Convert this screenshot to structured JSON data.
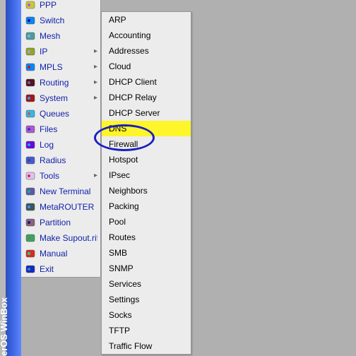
{
  "app": {
    "title_sideways": "erOS WinBox"
  },
  "menu": {
    "items": [
      {
        "label": "PPP",
        "icon": "ppp-icon",
        "arrow": false
      },
      {
        "label": "Switch",
        "icon": "switch-icon",
        "arrow": false
      },
      {
        "label": "Mesh",
        "icon": "mesh-icon",
        "arrow": false
      },
      {
        "label": "IP",
        "icon": "ip-icon",
        "arrow": true
      },
      {
        "label": "MPLS",
        "icon": "mpls-icon",
        "arrow": true
      },
      {
        "label": "Routing",
        "icon": "routing-icon",
        "arrow": true
      },
      {
        "label": "System",
        "icon": "system-icon",
        "arrow": true
      },
      {
        "label": "Queues",
        "icon": "queues-icon",
        "arrow": false
      },
      {
        "label": "Files",
        "icon": "files-icon",
        "arrow": false
      },
      {
        "label": "Log",
        "icon": "log-icon",
        "arrow": false
      },
      {
        "label": "Radius",
        "icon": "radius-icon",
        "arrow": false
      },
      {
        "label": "Tools",
        "icon": "tools-icon",
        "arrow": true
      },
      {
        "label": "New Terminal",
        "icon": "terminal-icon",
        "arrow": false
      },
      {
        "label": "MetaROUTER",
        "icon": "metarouter-icon",
        "arrow": false
      },
      {
        "label": "Partition",
        "icon": "partition-icon",
        "arrow": false
      },
      {
        "label": "Make Supout.rif",
        "icon": "supout-icon",
        "arrow": false
      },
      {
        "label": "Manual",
        "icon": "manual-icon",
        "arrow": false
      },
      {
        "label": "Exit",
        "icon": "exit-icon",
        "arrow": false
      }
    ]
  },
  "submenu": {
    "items": [
      {
        "label": "ARP"
      },
      {
        "label": "Accounting"
      },
      {
        "label": "Addresses"
      },
      {
        "label": "Cloud"
      },
      {
        "label": "DHCP Client"
      },
      {
        "label": "DHCP Relay"
      },
      {
        "label": "DHCP Server"
      },
      {
        "label": "DNS",
        "highlighted": true
      },
      {
        "label": "Firewall"
      },
      {
        "label": "Hotspot"
      },
      {
        "label": "IPsec"
      },
      {
        "label": "Neighbors"
      },
      {
        "label": "Packing"
      },
      {
        "label": "Pool"
      },
      {
        "label": "Routes"
      },
      {
        "label": "SMB"
      },
      {
        "label": "SNMP"
      },
      {
        "label": "Services"
      },
      {
        "label": "Settings"
      },
      {
        "label": "Socks"
      },
      {
        "label": "TFTP"
      },
      {
        "label": "Traffic Flow"
      }
    ]
  },
  "colors": {
    "highlight": "#fff52b",
    "circle": "#1b1fbf",
    "link": "#1122aa"
  }
}
